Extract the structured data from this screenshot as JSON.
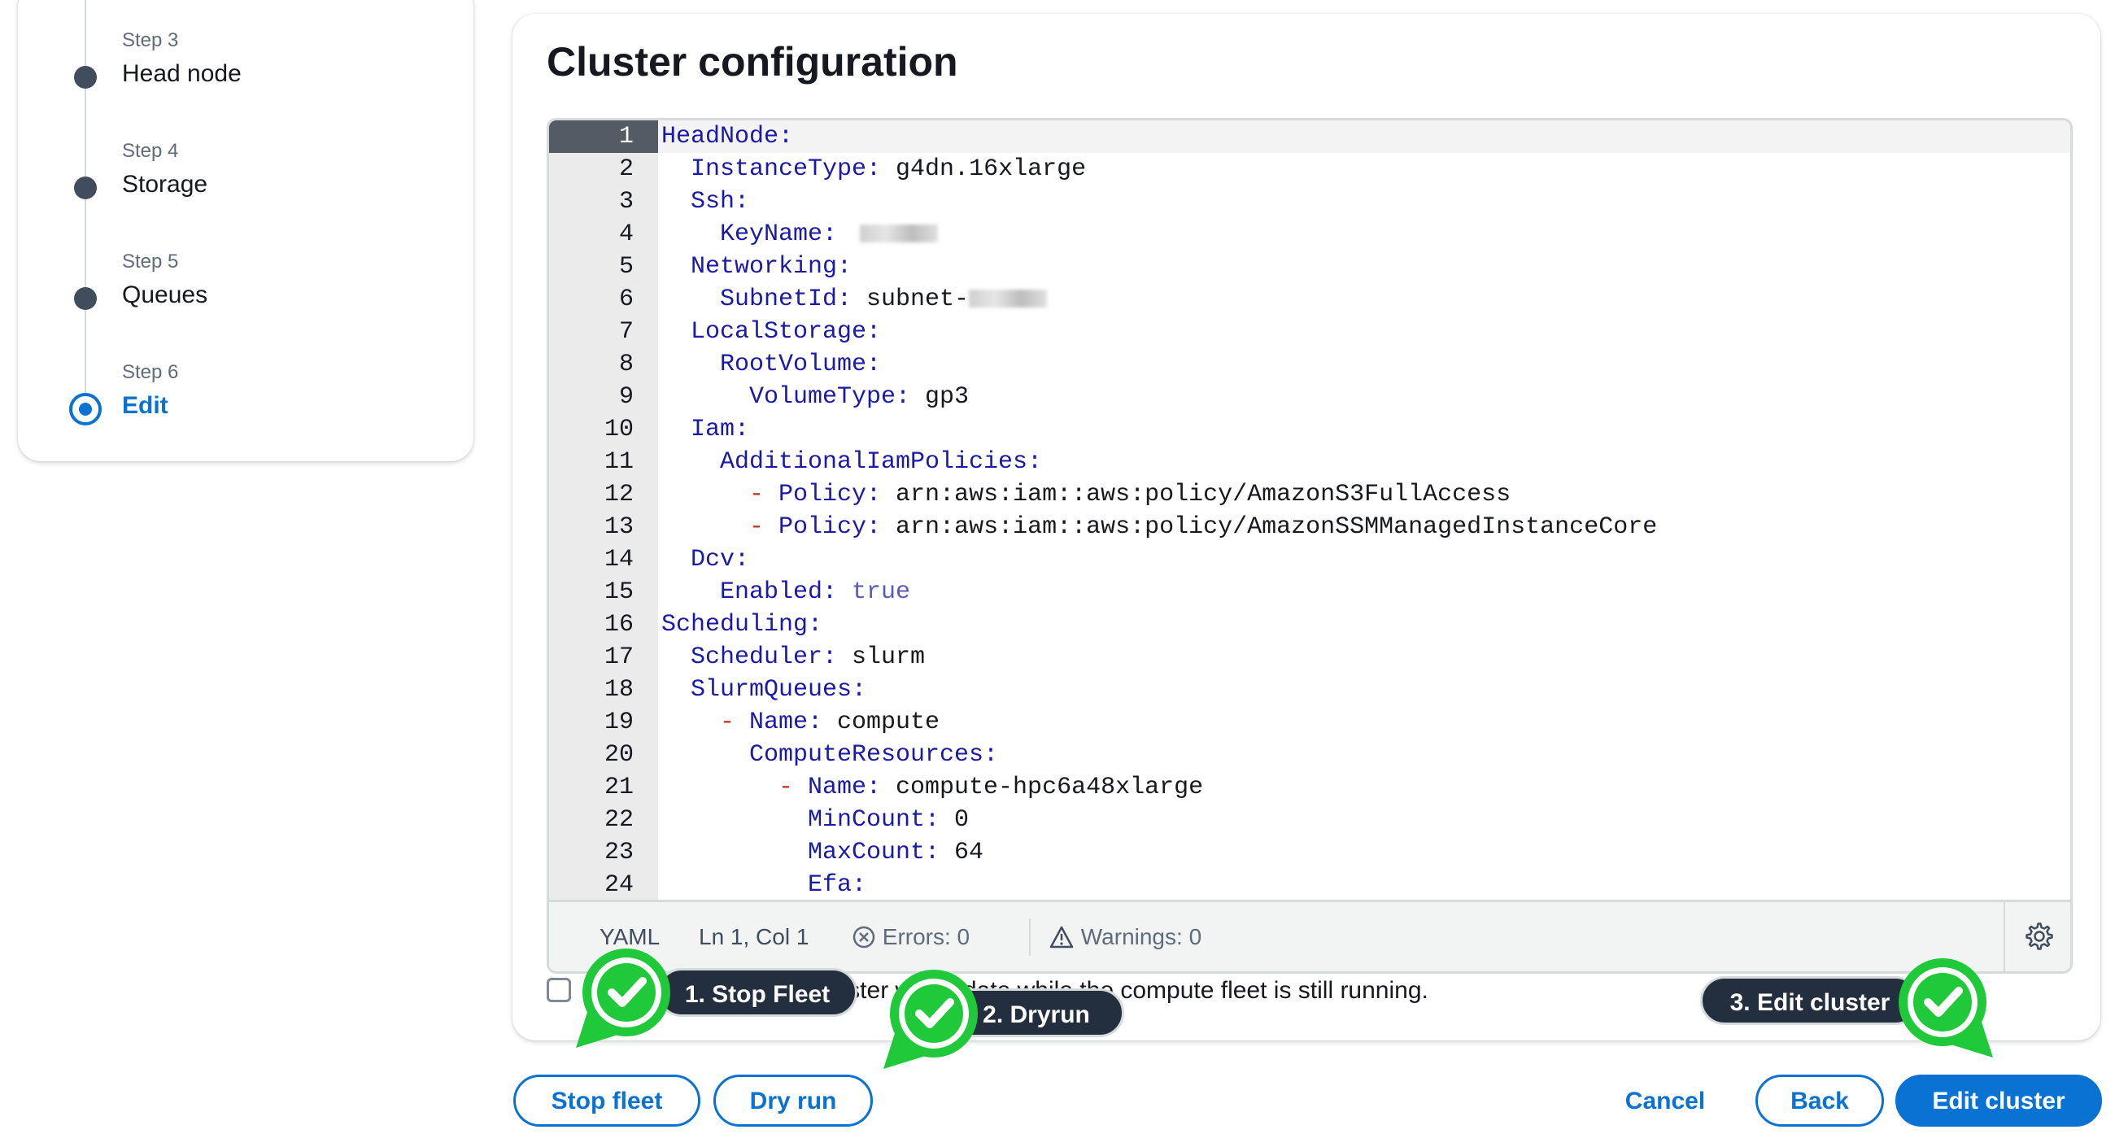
{
  "nav": {
    "steps": [
      {
        "num": "Step 3",
        "title": "Head node"
      },
      {
        "num": "Step 4",
        "title": "Storage"
      },
      {
        "num": "Step 5",
        "title": "Queues"
      },
      {
        "num": "Step 6",
        "title": "Edit"
      }
    ],
    "active_step": "Step 6"
  },
  "main": {
    "title": "Cluster configuration"
  },
  "editor": {
    "language": "YAML",
    "cursor": "Ln 1, Col 1",
    "errors": "Errors: 0",
    "warnings": "Warnings: 0",
    "lines": [
      {
        "n": "1",
        "indent": 0,
        "dash": false,
        "key": "HeadNode:",
        "val": ""
      },
      {
        "n": "2",
        "indent": 2,
        "dash": false,
        "key": "InstanceType:",
        "val": "g4dn.16xlarge"
      },
      {
        "n": "3",
        "indent": 2,
        "dash": false,
        "key": "Ssh:",
        "val": ""
      },
      {
        "n": "4",
        "indent": 4,
        "dash": false,
        "key": "KeyName:",
        "val": "",
        "redacted": true
      },
      {
        "n": "5",
        "indent": 2,
        "dash": false,
        "key": "Networking:",
        "val": ""
      },
      {
        "n": "6",
        "indent": 4,
        "dash": false,
        "key": "SubnetId:",
        "val": "subnet-",
        "redacted": true
      },
      {
        "n": "7",
        "indent": 2,
        "dash": false,
        "key": "LocalStorage:",
        "val": ""
      },
      {
        "n": "8",
        "indent": 4,
        "dash": false,
        "key": "RootVolume:",
        "val": ""
      },
      {
        "n": "9",
        "indent": 6,
        "dash": false,
        "key": "VolumeType:",
        "val": "gp3"
      },
      {
        "n": "10",
        "indent": 2,
        "dash": false,
        "key": "Iam:",
        "val": ""
      },
      {
        "n": "11",
        "indent": 4,
        "dash": false,
        "key": "AdditionalIamPolicies:",
        "val": ""
      },
      {
        "n": "12",
        "indent": 6,
        "dash": true,
        "key": "Policy:",
        "val": "arn:aws:iam::aws:policy/AmazonS3FullAccess"
      },
      {
        "n": "13",
        "indent": 6,
        "dash": true,
        "key": "Policy:",
        "val": "arn:aws:iam::aws:policy/AmazonSSMManagedInstanceCore"
      },
      {
        "n": "14",
        "indent": 2,
        "dash": false,
        "key": "Dcv:",
        "val": ""
      },
      {
        "n": "15",
        "indent": 4,
        "dash": false,
        "key": "Enabled:",
        "val": "true",
        "bool": true
      },
      {
        "n": "16",
        "indent": 0,
        "dash": false,
        "key": "Scheduling:",
        "val": ""
      },
      {
        "n": "17",
        "indent": 2,
        "dash": false,
        "key": "Scheduler:",
        "val": "slurm"
      },
      {
        "n": "18",
        "indent": 2,
        "dash": false,
        "key": "SlurmQueues:",
        "val": ""
      },
      {
        "n": "19",
        "indent": 4,
        "dash": true,
        "key": "Name:",
        "val": "compute"
      },
      {
        "n": "20",
        "indent": 6,
        "dash": false,
        "key": "ComputeResources:",
        "val": ""
      },
      {
        "n": "21",
        "indent": 8,
        "dash": true,
        "key": "Name:",
        "val": "compute-hpc6a48xlarge"
      },
      {
        "n": "22",
        "indent": 10,
        "dash": false,
        "key": "MinCount:",
        "val": "0"
      },
      {
        "n": "23",
        "indent": 10,
        "dash": false,
        "key": "MaxCount:",
        "val": "64"
      },
      {
        "n": "24",
        "indent": 10,
        "dash": false,
        "key": "Efa:",
        "val": ""
      }
    ]
  },
  "checkbox_text": "I understand that my cluster will update while the compute fleet is still running.",
  "buttons": {
    "stop_fleet": "Stop fleet",
    "dry_run": "Dry run",
    "cancel": "Cancel",
    "back": "Back",
    "edit_cluster": "Edit cluster"
  },
  "annotations": {
    "a1": "1. Stop Fleet",
    "a2": "2. Dryrun",
    "a3": "3. Edit cluster"
  },
  "colors": {
    "accent": "#0972d3",
    "yaml_key": "#1a1aa6",
    "badge_green": "#1fc93a"
  },
  "icons": {
    "errors": "circle-x-icon",
    "warnings": "warning-triangle-icon",
    "settings": "gear-icon",
    "badge": "green-check-badge-icon"
  }
}
